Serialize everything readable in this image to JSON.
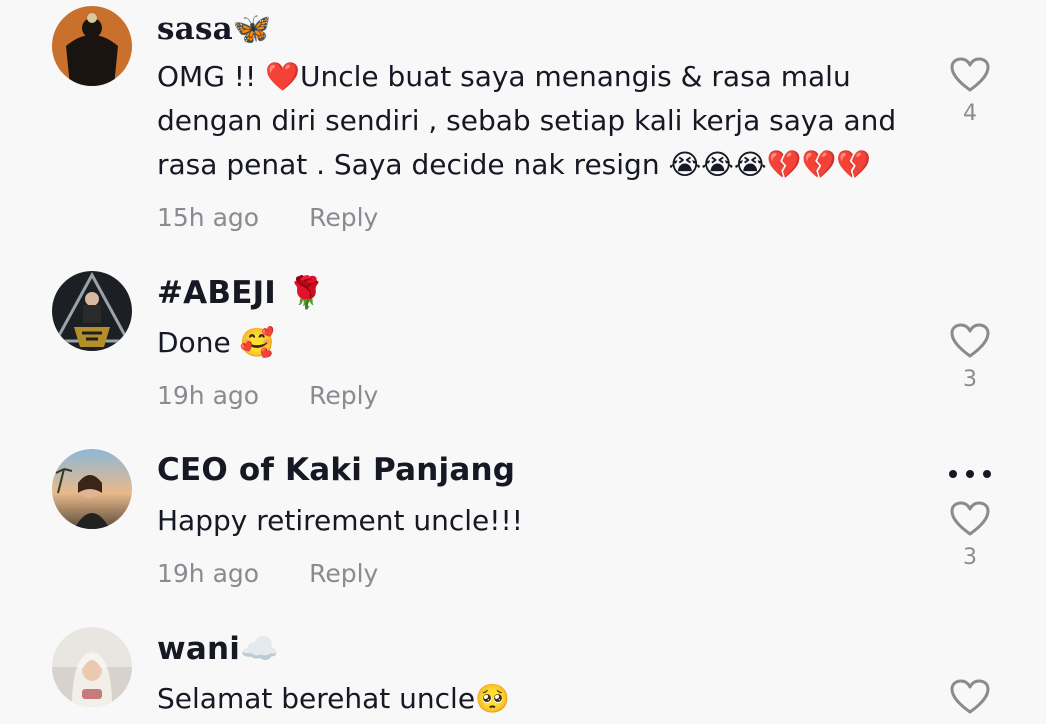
{
  "comments": [
    {
      "username": "sasa🦋",
      "text": "OMG !! ❤️Uncle buat saya menangis & rasa malu dengan diri sendiri , sebab setiap kali kerja saya and rasa penat . Saya decide nak resign 😭😭😭💔💔💔",
      "time": "15h ago",
      "reply": "Reply",
      "likes": "4",
      "like_icon": "heart-outline-icon"
    },
    {
      "username": "#ABEJI 🌹",
      "text": "Done 🥰",
      "time": "19h ago",
      "reply": "Reply",
      "likes": "3",
      "like_icon": "heart-outline-icon"
    },
    {
      "username": "CEO of Kaki Panjang",
      "text": "Happy retirement uncle!!!",
      "time": "19h ago",
      "reply": "Reply",
      "likes": "3",
      "like_icon": "heart-outline-icon",
      "more_icon": "more-options-icon"
    },
    {
      "username": "wani☁️",
      "text": "Selamat berehat uncle🥺",
      "like_icon": "heart-outline-icon"
    }
  ]
}
